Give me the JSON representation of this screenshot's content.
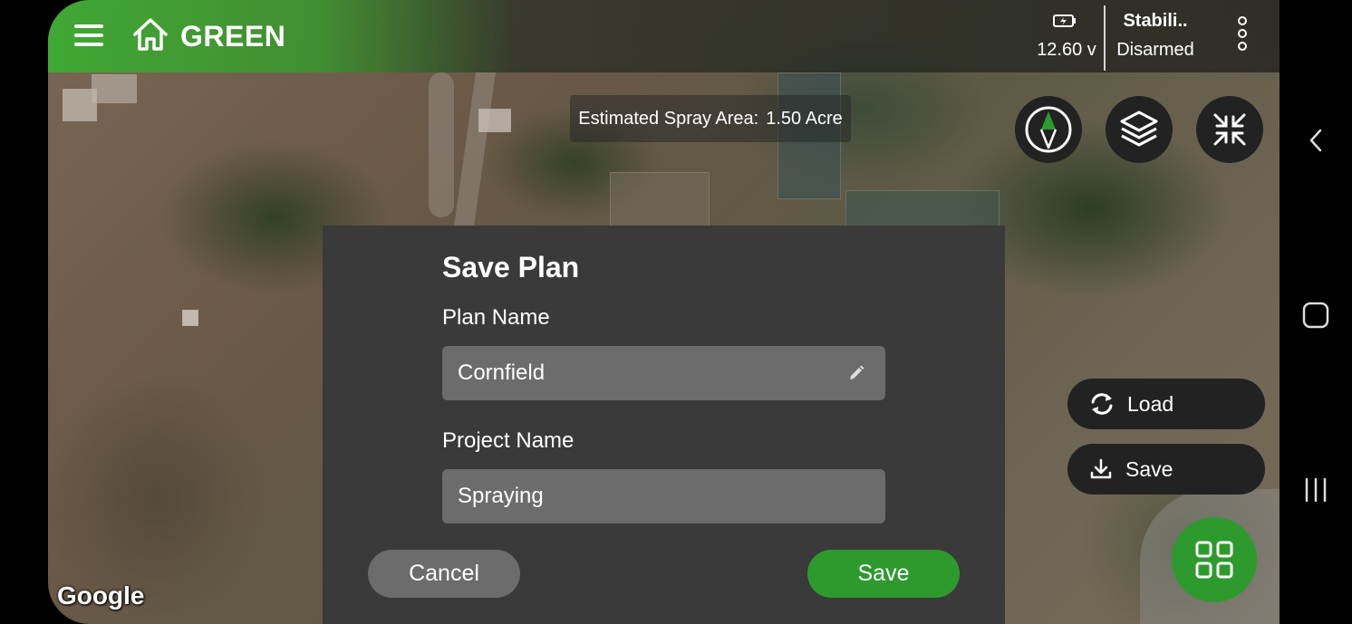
{
  "topbar": {
    "brand": "GREEN",
    "voltage": "12.60 v",
    "flight_mode": "Stabili..",
    "arm_state": "Disarmed"
  },
  "map": {
    "spray_area_label": "Estimated Spray Area:",
    "spray_area_value": "1.50 Acre",
    "attribution": "Google"
  },
  "side_actions": {
    "load_label": "Load",
    "save_label": "Save"
  },
  "dialog": {
    "title": "Save Plan",
    "plan_name_label": "Plan Name",
    "plan_name_value": "Cornfield",
    "project_name_label": "Project Name",
    "project_name_value": "Spraying",
    "cancel_label": "Cancel",
    "save_label": "Save"
  },
  "colors": {
    "accent_green": "#2d9a2d",
    "dialog_bg": "#3a3a3a",
    "field_bg": "#6c6c6c"
  },
  "icons": [
    "menu-icon",
    "home-icon",
    "battery-icon",
    "more-vert-icon",
    "compass-icon",
    "layers-icon",
    "collapse-icon",
    "refresh-icon",
    "download-icon",
    "grid-icon",
    "pencil-icon",
    "back-icon",
    "home-nav-icon",
    "recents-icon"
  ]
}
